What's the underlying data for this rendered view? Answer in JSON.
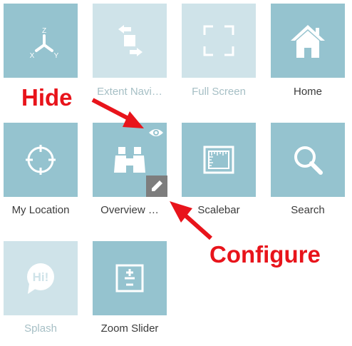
{
  "widgets": [
    {
      "label": "",
      "icon": "axes-3d-icon",
      "enabled": true
    },
    {
      "label": "Extent Navi…",
      "icon": "extent-navigate-icon",
      "enabled": false
    },
    {
      "label": "Full Screen",
      "icon": "full-screen-icon",
      "enabled": false
    },
    {
      "label": "Home",
      "icon": "home-icon",
      "enabled": true
    },
    {
      "label": "My Location",
      "icon": "my-location-icon",
      "enabled": true
    },
    {
      "label": "Overview …",
      "icon": "binoculars-icon",
      "enabled": true
    },
    {
      "label": "Scalebar",
      "icon": "scalebar-icon",
      "enabled": true
    },
    {
      "label": "Search",
      "icon": "search-icon",
      "enabled": true
    },
    {
      "label": "Splash",
      "icon": "splash-icon",
      "enabled": false
    },
    {
      "label": "Zoom Slider",
      "icon": "zoom-slider-icon",
      "enabled": true
    }
  ],
  "axes_icon_letters": {
    "z": "Z",
    "x": "X",
    "y": "Y"
  },
  "splash_icon_text": "Hi!",
  "hover_controls": {
    "hide": "eye-icon",
    "configure": "pencil-icon"
  },
  "annotations": {
    "hide": "Hide",
    "configure": "Configure"
  },
  "colors": {
    "tile": "#95c3cf",
    "tile_disabled": "#cfe3e9",
    "label": "#3b3b3b",
    "label_disabled": "#a6bfc5",
    "annotation": "#e8141b",
    "edit_button": "#7d7d7d"
  }
}
